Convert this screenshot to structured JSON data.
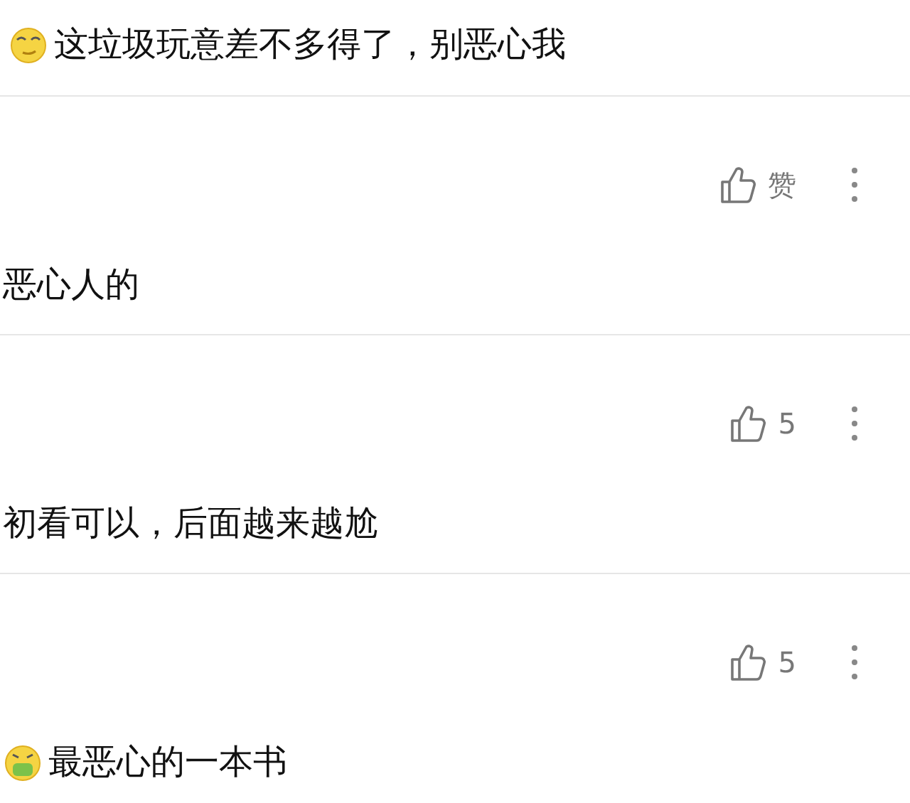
{
  "comments": [
    {
      "emoji": {
        "kind": "smug"
      },
      "text": "这垃圾玩意差不多得了，别恶心我"
    },
    {
      "like": "赞",
      "text": "恶心人的"
    },
    {
      "like": "5",
      "text": "初看可以，后面越来越尬"
    },
    {
      "like": "5",
      "emoji": {
        "kind": "sick"
      },
      "text": "最恶心的一本书"
    }
  ]
}
